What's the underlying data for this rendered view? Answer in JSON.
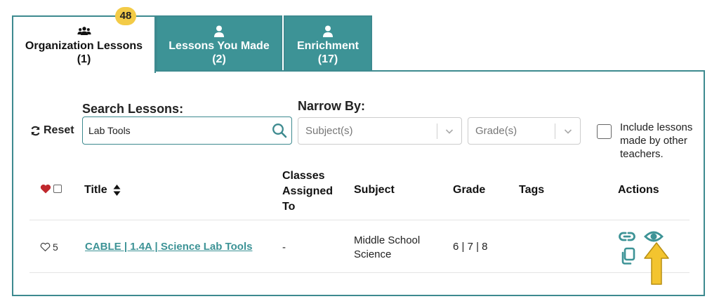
{
  "tabs": {
    "organization": {
      "label": "Organization Lessons",
      "count": "(1)",
      "badge": "48"
    },
    "made": {
      "label": "Lessons You Made",
      "count": "(2)"
    },
    "enrichment": {
      "label": "Enrichment",
      "count": "(17)"
    }
  },
  "filters": {
    "reset_label": "Reset",
    "search_label": "Search Lessons:",
    "search_value": "Lab Tools",
    "narrow_label": "Narrow By:",
    "subject_placeholder": "Subject(s)",
    "grade_placeholder": "Grade(s)",
    "include_label": "Include lessons made by other teachers."
  },
  "table": {
    "headers": {
      "title": "Title",
      "classes_line1": "Classes",
      "classes_line2": "Assigned",
      "classes_line3": "To",
      "subject": "Subject",
      "grade": "Grade",
      "tags": "Tags",
      "actions": "Actions"
    },
    "rows": [
      {
        "likes": "5",
        "title": "CABLE | 1.4A | Science Lab Tools",
        "classes": "-",
        "subject_line1": "Middle School",
        "subject_line2": "Science",
        "grade": "6 | 7 | 8",
        "tags": ""
      }
    ]
  },
  "colors": {
    "teal": "#3d9396",
    "badge_yellow": "#f3cb47",
    "heart_red": "#c0282d",
    "annotation_arrow": "#f3c42f"
  },
  "icons": [
    "users-icon",
    "user-icon",
    "refresh-icon",
    "search-icon",
    "chevron-down-icon",
    "heart-icon",
    "heart-outline-icon",
    "sort-icon",
    "link-icon",
    "eye-icon",
    "copy-icon",
    "arrow-up-icon"
  ]
}
